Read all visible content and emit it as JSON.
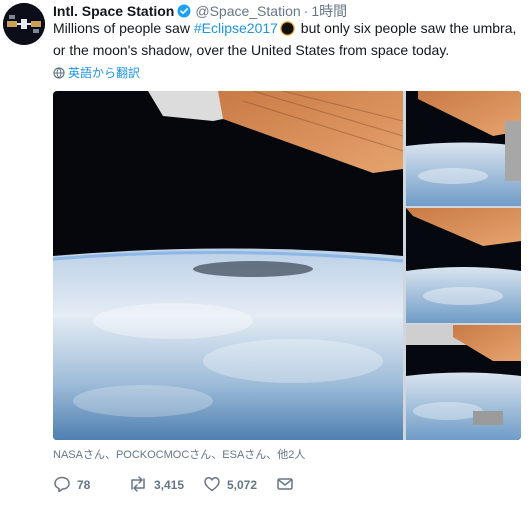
{
  "tweet": {
    "author": {
      "display_name": "Intl. Space Station",
      "handle": "@Space_Station",
      "verified_icon": "verified-badge-icon",
      "avatar_icon": "iss-avatar-icon"
    },
    "separator": "·",
    "time": "1時間",
    "text_part1": "Millions of people saw ",
    "hashtag": "#Eclipse2017",
    "text_part2": " but only six people saw the umbra, or the moon's shadow, over the United States from space today.",
    "emoji_icon": "eclipse-emoji-icon",
    "translate_label": "英語から翻訳",
    "liked_by": "NASAさん、POCKOCMOCさん、ESAさん、他2人",
    "actions": {
      "reply_count": "78",
      "retweet_count": "3,415",
      "like_count": "5,072"
    }
  },
  "colors": {
    "link": "#1b95e0",
    "secondary": "#657786",
    "verified": "#1da1f2"
  }
}
